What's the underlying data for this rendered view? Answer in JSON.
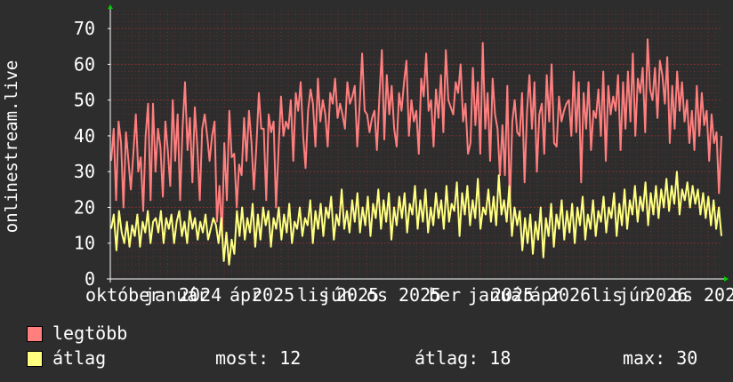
{
  "chart_data": {
    "type": "line",
    "ylabel": "onlinestream.live",
    "ylim": [
      0,
      75
    ],
    "yticks": [
      0,
      10,
      20,
      30,
      40,
      50,
      60,
      70
    ],
    "xtick_labels": [
      "október",
      "január",
      "2024",
      "ápr",
      "2025",
      "lis",
      "jún",
      "2025",
      "os",
      "2025",
      "ber",
      "január",
      "2025",
      "ápr",
      "2026",
      "lis",
      "jún",
      "2026",
      "os",
      "202"
    ],
    "grid": true,
    "colors": {
      "background": "#2d2d2d",
      "grid": "#8a3030",
      "axis": "#ffffff",
      "text": "#ffffff",
      "arrow": "#00cc00"
    },
    "series": [
      {
        "name": "legtöbb",
        "color": "#ff7f7f",
        "values": [
          33,
          42,
          22,
          44,
          38,
          20,
          41,
          33,
          25,
          35,
          46,
          30,
          34,
          19,
          40,
          49,
          22,
          49,
          30,
          42,
          37,
          23,
          44,
          36,
          26,
          50,
          33,
          46,
          22,
          42,
          55,
          36,
          45,
          27,
          48,
          37,
          22,
          42,
          46,
          40,
          33,
          40,
          44,
          16,
          26,
          12,
          38,
          22,
          47,
          34,
          35,
          20,
          32,
          29,
          45,
          33,
          47,
          38,
          25,
          37,
          52,
          42,
          42,
          22,
          46,
          41,
          44,
          20,
          36,
          51,
          40,
          44,
          42,
          50,
          33,
          52,
          47,
          55,
          40,
          31,
          47,
          53,
          49,
          37,
          56,
          44,
          50,
          46,
          37,
          52,
          49,
          56,
          45,
          49,
          46,
          42,
          55,
          49,
          51,
          54,
          37,
          49,
          63,
          47,
          46,
          41,
          45,
          47,
          36,
          51,
          64,
          39,
          57,
          46,
          54,
          42,
          37,
          52,
          47,
          55,
          61,
          40,
          50,
          44,
          47,
          35,
          56,
          51,
          63,
          47,
          50,
          37,
          53,
          45,
          57,
          41,
          64,
          50,
          48,
          46,
          55,
          52,
          60,
          44,
          49,
          35,
          38,
          59,
          43,
          55,
          35,
          66,
          42,
          52,
          33,
          56,
          46,
          42,
          29,
          43,
          29,
          54,
          20,
          44,
          50,
          41,
          40,
          52,
          27,
          47,
          57,
          42,
          55,
          30,
          46,
          49,
          35,
          57,
          44,
          60,
          38,
          37,
          51,
          44,
          47,
          49,
          50,
          40,
          58,
          41,
          55,
          27,
          52,
          42,
          55,
          36,
          47,
          45,
          53,
          40,
          58,
          33,
          54,
          46,
          51,
          47,
          57,
          36,
          55,
          42,
          58,
          44,
          63,
          40,
          56,
          52,
          59,
          41,
          67,
          53,
          50,
          59,
          45,
          61,
          57,
          49,
          62,
          38,
          54,
          42,
          58,
          47,
          55,
          44,
          50,
          38,
          47,
          36,
          54,
          40,
          52,
          43,
          47,
          33,
          46,
          38,
          41,
          24,
          40
        ]
      },
      {
        "name": "átlag",
        "color": "#ffff80",
        "values": [
          14,
          18,
          8,
          19,
          13,
          10,
          16,
          9,
          15,
          12,
          18,
          9,
          16,
          13,
          19,
          10,
          16,
          17,
          13,
          19,
          10,
          17,
          14,
          18,
          10,
          16,
          19,
          12,
          16,
          10,
          19,
          14,
          17,
          11,
          16,
          13,
          18,
          11,
          14,
          17,
          15,
          10,
          17,
          5,
          13,
          4,
          11,
          7,
          19,
          12,
          20,
          11,
          17,
          13,
          21,
          9,
          18,
          11,
          20,
          15,
          19,
          9,
          17,
          14,
          20,
          11,
          18,
          13,
          21,
          10,
          16,
          14,
          20,
          12,
          17,
          15,
          22,
          10,
          19,
          14,
          21,
          12,
          20,
          17,
          23,
          11,
          18,
          15,
          25,
          14,
          19,
          13,
          22,
          16,
          24,
          13,
          20,
          15,
          23,
          12,
          21,
          17,
          25,
          14,
          22,
          16,
          24,
          11,
          20,
          15,
          23,
          17,
          24,
          13,
          21,
          18,
          26,
          14,
          22,
          16,
          25,
          13,
          20,
          15,
          24,
          17,
          22,
          14,
          26,
          16,
          21,
          19,
          27,
          12,
          24,
          18,
          26,
          15,
          22,
          17,
          28,
          14,
          20,
          18,
          25,
          16,
          23,
          15,
          29,
          18,
          22,
          16,
          26,
          12,
          20,
          15,
          19,
          8,
          17,
          10,
          18,
          7,
          16,
          11,
          20,
          6,
          17,
          12,
          21,
          9,
          18,
          14,
          22,
          11,
          19,
          13,
          21,
          10,
          20,
          15,
          23,
          11,
          18,
          14,
          22,
          12,
          19,
          16,
          23,
          13,
          20,
          17,
          24,
          12,
          21,
          15,
          25,
          14,
          22,
          18,
          26,
          16,
          23,
          19,
          27,
          15,
          24,
          18,
          26,
          17,
          25,
          20,
          28,
          19,
          26,
          21,
          30,
          18,
          25,
          22,
          27,
          20,
          26,
          21,
          25,
          18,
          24,
          17,
          23,
          15,
          22,
          14,
          20,
          12
        ]
      }
    ],
    "legend_position": "bottom-left"
  },
  "legend": {
    "items": [
      {
        "label": "legtöbb",
        "color": "#ff7f7f"
      },
      {
        "label": "átlag",
        "color": "#ffff80"
      }
    ],
    "stats": {
      "most": "most: 12",
      "atlag": "átlag: 18",
      "max": "max: 30"
    }
  }
}
